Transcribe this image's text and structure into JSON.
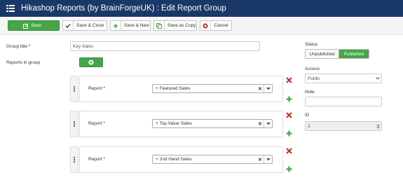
{
  "header": {
    "title": "Hikashop Reports (by BrainForgeUK) : Edit Report Group"
  },
  "toolbar": {
    "save_label": "Save",
    "save_close_label": "Save & Close",
    "save_new_label": "Save & New",
    "save_copy_label": "Save as Copy",
    "cancel_label": "Cancel"
  },
  "form": {
    "group_title_label": "Group title *",
    "group_title_value": "Key Sales",
    "reports_label": "Reports in group",
    "report_label": "Report *",
    "reports": [
      {
        "value": "+ Featured Sales"
      },
      {
        "value": "+ Top Value Sales"
      },
      {
        "value": "+ 2nd Hand Sales"
      }
    ]
  },
  "sidebar": {
    "status_label": "Status",
    "unpublished_label": "Unpublished",
    "published_label": "Published",
    "access_label": "Access",
    "access_value": "Public",
    "note_label": "Note",
    "note_value": "",
    "id_label": "ID",
    "id_value": "2"
  },
  "colors": {
    "header_bg": "#1a3867",
    "success": "#46a546",
    "danger": "#bd362f"
  }
}
